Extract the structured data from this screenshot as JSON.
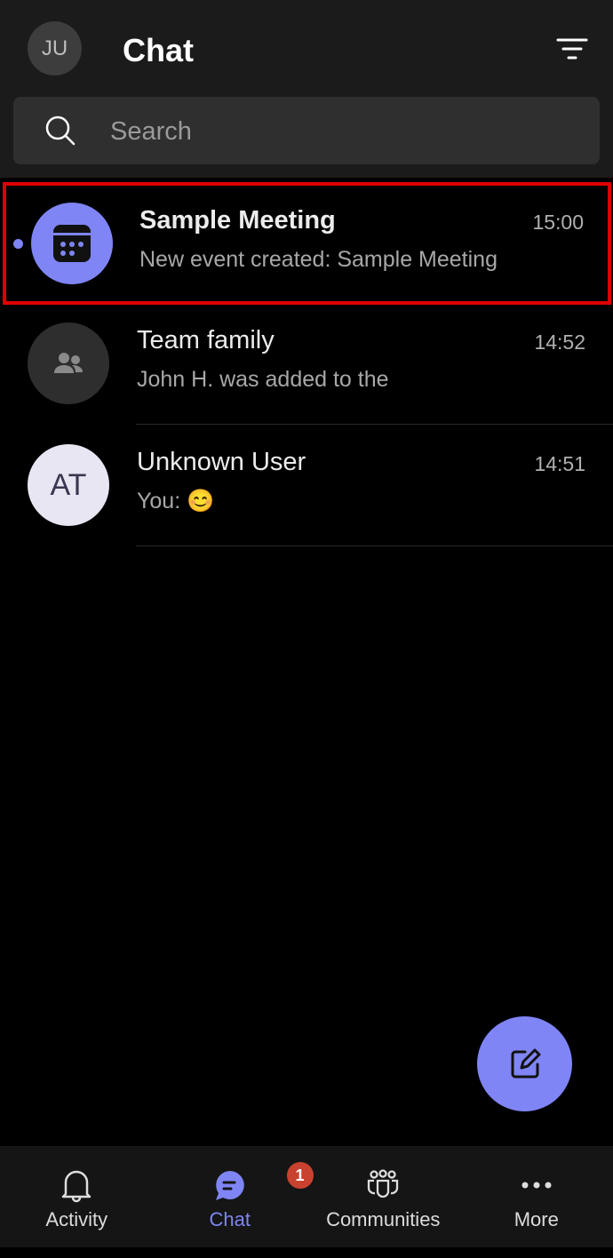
{
  "header": {
    "avatar_initials": "JU",
    "title": "Chat",
    "filter_icon": "filter-icon"
  },
  "search": {
    "placeholder": "Search"
  },
  "chats": [
    {
      "name": "Sample Meeting",
      "time": "15:00",
      "preview": "New event created: Sample Meeting",
      "unread": true,
      "icon": "calendar-icon",
      "avatar_color": "#7f85f5"
    },
    {
      "name": "Team family",
      "time": "14:52",
      "preview": "John H. was added to the",
      "icon": "people-icon",
      "avatar_color": "#2e2e2e"
    },
    {
      "name": "Unknown User",
      "time": "14:51",
      "preview": "You: 😊",
      "initials": "AT",
      "avatar_color": "#e8e6f2"
    }
  ],
  "fab": {
    "icon": "compose-icon"
  },
  "nav": {
    "tabs": [
      {
        "label": "Activity",
        "icon": "bell-icon"
      },
      {
        "label": "Chat",
        "icon": "chat-icon",
        "badge": "1",
        "active": true
      },
      {
        "label": "Communities",
        "icon": "communities-icon"
      },
      {
        "label": "More",
        "icon": "more-icon"
      }
    ]
  },
  "colors": {
    "accent": "#7f85f5",
    "badge": "#c8422f",
    "highlight": "#e00000"
  }
}
